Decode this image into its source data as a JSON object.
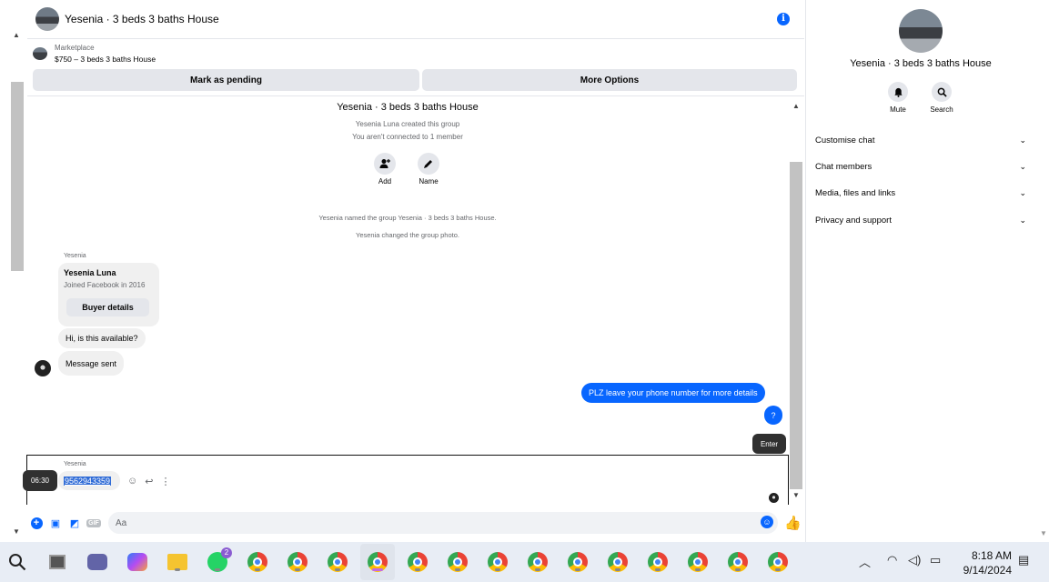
{
  "header": {
    "title": "Yesenia · 3 beds 3 baths House"
  },
  "marketplace": {
    "label": "Marketplace",
    "listing": "$750 – 3 beds 3 baths House",
    "mark_pending": "Mark as pending",
    "more_options": "More Options"
  },
  "conversation": {
    "title": "Yesenia · 3 beds 3 baths House",
    "created": "Yesenia Luna created this group",
    "connection": "You aren't connected to 1 member",
    "add_label": "Add",
    "name_label": "Name",
    "event_named": "Yesenia named the group Yesenia · 3 beds 3 baths House.",
    "event_photo": "Yesenia changed the group photo.",
    "sender": "Yesenia",
    "card_name": "Yesenia Luna",
    "card_sub": "Joined Facebook in 2016",
    "card_button": "Buyer details",
    "msg_available": "Hi, is this available?",
    "msg_sent": "Message sent",
    "out_msg_1": "PLZ leave your phone number for more details",
    "out_msg_2": "?",
    "enter_tooltip": "Enter"
  },
  "reply": {
    "sender": "Yesenia",
    "time_tooltip": "06:30",
    "selected_text": "9562943359"
  },
  "composer": {
    "placeholder": "Aa",
    "gif": "GIF"
  },
  "right_panel": {
    "title": "Yesenia · 3 beds 3 baths House",
    "mute": "Mute",
    "search": "Search",
    "sections": [
      "Customise chat",
      "Chat members",
      "Media, files and links",
      "Privacy and support"
    ]
  },
  "taskbar": {
    "whatsapp_badge": "2",
    "time": "8:18 AM",
    "date": "9/14/2024"
  },
  "colors": {
    "accent": "#0866ff",
    "bubble_in": "#f0f0f0",
    "taskbar": "#e8edf5"
  }
}
